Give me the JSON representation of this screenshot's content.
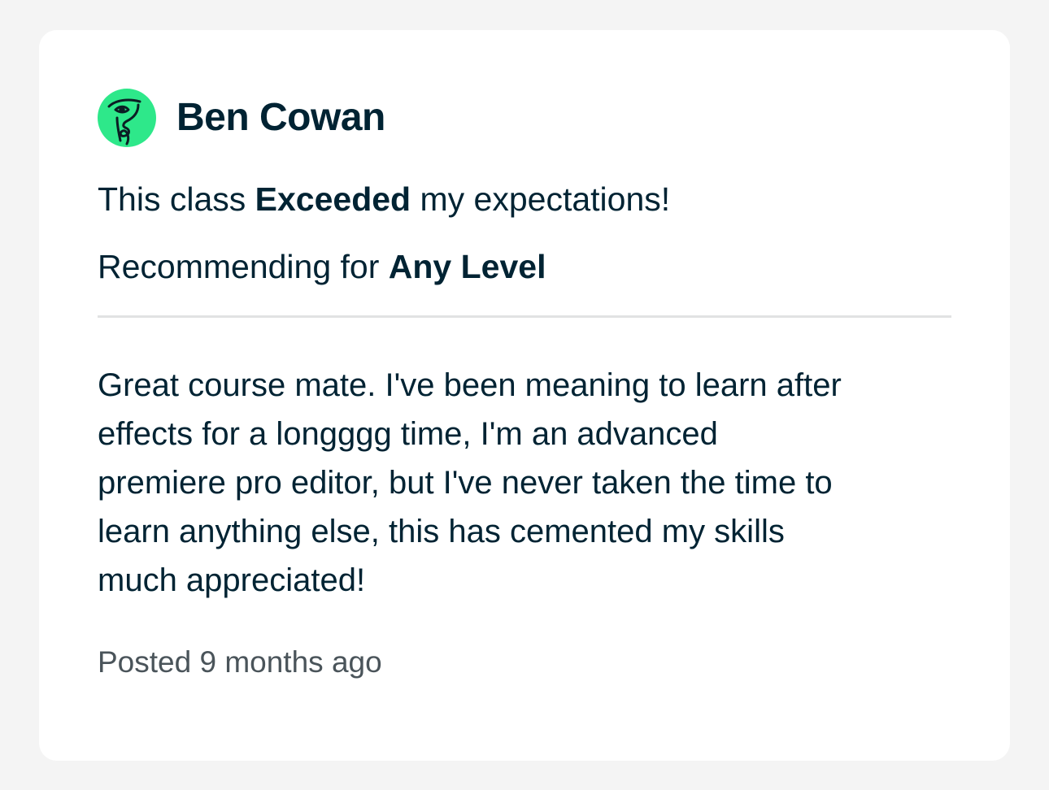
{
  "review": {
    "author": {
      "name": "Ben Cowan",
      "avatar_icon": "face-line-drawing-icon",
      "avatar_color": "#2ee88a"
    },
    "rating": {
      "prefix": "This class ",
      "value": "Exceeded",
      "suffix": " my expectations!"
    },
    "recommendation": {
      "prefix": "Recommending for ",
      "level": "Any Level"
    },
    "body": "Great course mate. I've been meaning to learn after\neffects for a longggg time, I'm an advanced\npremiere pro editor, but I've never taken the time to\nlearn anything else, this has cemented my skills\nmuch appreciated!",
    "posted": "Posted 9 months ago"
  },
  "colors": {
    "text": "#002333",
    "muted_text": "#4a545a",
    "divider": "#e1e2e3",
    "card_background": "#ffffff",
    "page_background": "#f4f4f4"
  }
}
